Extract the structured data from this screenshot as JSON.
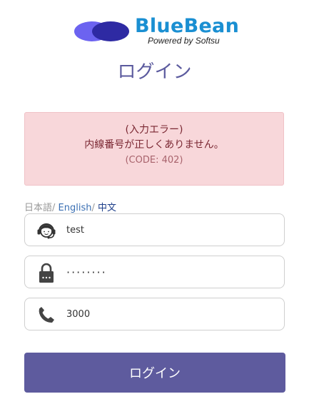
{
  "brand": {
    "name": "BlueBean",
    "tagline": "Powered by Softsu",
    "colors": {
      "oval_left": "#6c63f0",
      "oval_right": "#2e2aa3",
      "text": "#1a8fd2"
    }
  },
  "page": {
    "title": "ログイン"
  },
  "alert": {
    "heading": "(入力エラー)",
    "message": "内線番号が正しくありません。",
    "code": "(CODE: 402)",
    "bg_color": "#f8d7da"
  },
  "languages": {
    "ja": "日本語",
    "sep1": "/ ",
    "en": "English",
    "sep2": "/ ",
    "zh": "中文"
  },
  "form": {
    "username": {
      "value": "test",
      "icon": "operator-headset-icon"
    },
    "password": {
      "value": "········",
      "icon": "lock-icon"
    },
    "extension": {
      "value": "3000",
      "icon": "phone-icon"
    }
  },
  "buttons": {
    "login": "ログイン",
    "login_color": "#5e5b9e"
  }
}
